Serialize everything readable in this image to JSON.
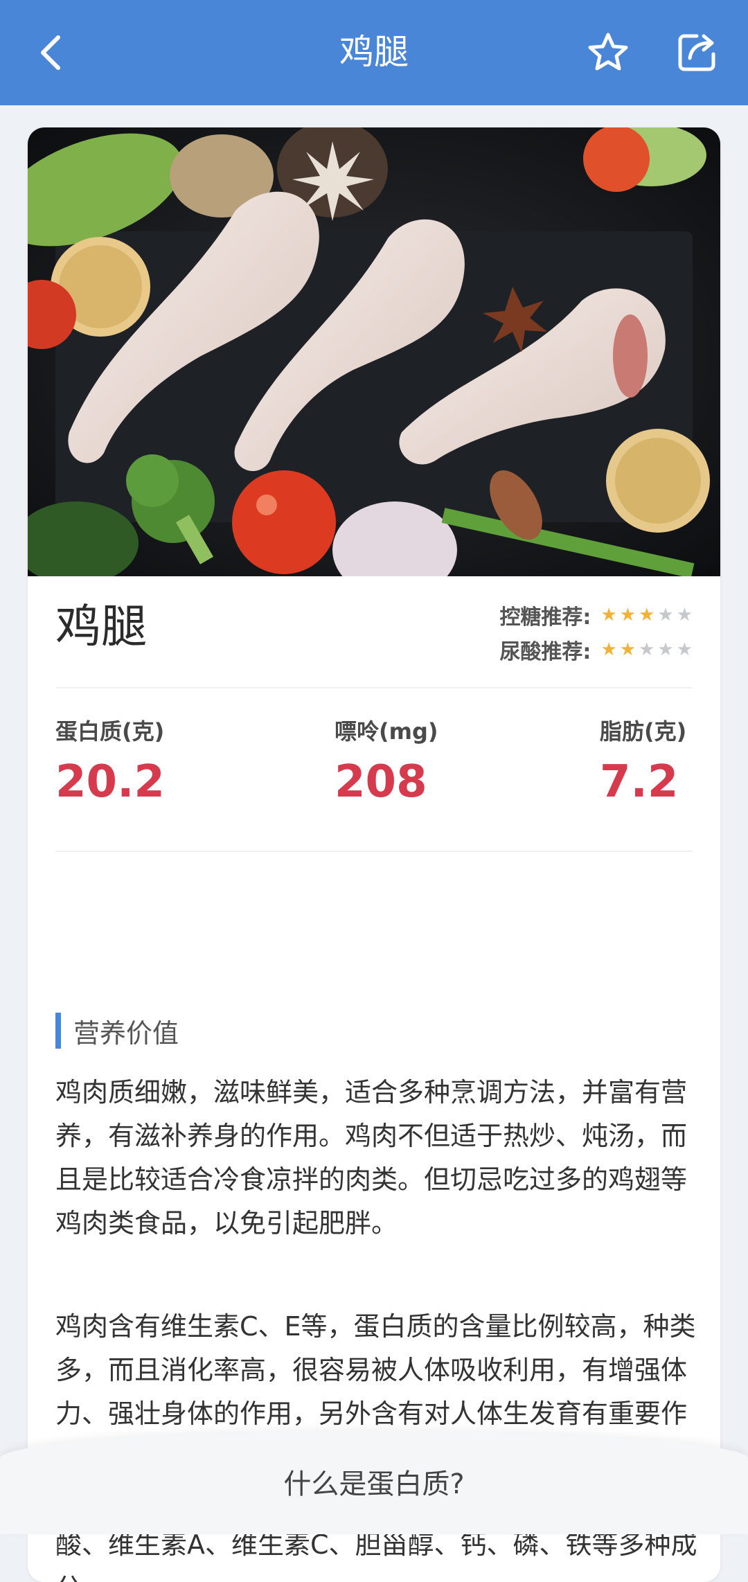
{
  "header": {
    "title": "鸡腿",
    "back_icon": "chevron-left-icon",
    "favorite_icon": "star-outline-icon",
    "share_icon": "share-icon",
    "color": "#4a86d8"
  },
  "food": {
    "name": "鸡腿",
    "image": "photo of raw chicken drumsticks with vegetables",
    "ratings": [
      {
        "label": "控糖推荐:",
        "stars": 3,
        "max": 5
      },
      {
        "label": "尿酸推荐:",
        "stars": 2,
        "max": 5
      }
    ]
  },
  "nutrition": [
    {
      "label": "蛋白质(克)",
      "value": "20.2"
    },
    {
      "label": "嘌呤(mg)",
      "value": "208"
    },
    {
      "label": "脂肪(克)",
      "value": "7.2"
    }
  ],
  "section": {
    "title": "营养价值",
    "paragraphs": [
      "鸡肉质细嫩，滋味鲜美，适合多种烹调方法，并富有营养，有滋补养身的作用。鸡肉不但适于热炒、炖汤，而且是比较适合冷食凉拌的肉类。但切忌吃过多的鸡翅等鸡肉类食品，以免引起肥胖。",
      "鸡肉含有维生素C、E等，蛋白质的含量比例较高，种类多，而且消化率高，很容易被人体吸收利用，有增强体力、强壮身体的作用，另外含有对人体生发育有重要作用的磷脂类，是中国人膳食结构中脂肪和磷脂的重要来源之一。含有蛋白质、脂肪、硫胺素、核黄素、尼克酸、维生素A、维生素C、胆甾醇、钙、磷、铁等多种成分。"
    ]
  },
  "bottom": {
    "question": "什么是蛋白质?"
  }
}
